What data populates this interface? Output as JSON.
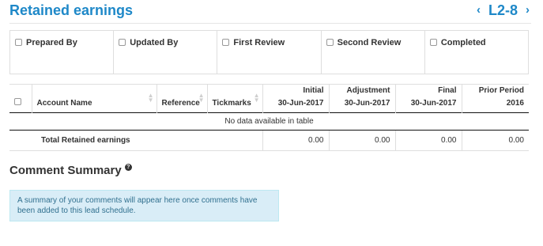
{
  "header": {
    "title": "Retained earnings",
    "prev_label": "‹",
    "code": "L2-8",
    "next_label": "›"
  },
  "signoff": [
    {
      "label": "Prepared By"
    },
    {
      "label": "Updated By"
    },
    {
      "label": "First Review"
    },
    {
      "label": "Second Review"
    },
    {
      "label": "Completed"
    }
  ],
  "table": {
    "columns": {
      "account": "Account Name",
      "reference": "Reference",
      "tickmarks": "Tickmarks",
      "initial_1": "Initial",
      "initial_2": "30-Jun-2017",
      "adjustment_1": "Adjustment",
      "adjustment_2": "30-Jun-2017",
      "final_1": "Final",
      "final_2": "30-Jun-2017",
      "prior_1": "Prior Period",
      "prior_2": "2016"
    },
    "empty_message": "No data available in table",
    "total": {
      "label": "Total Retained earnings",
      "initial": "0.00",
      "adjustment": "0.00",
      "final": "0.00",
      "prior": "0.00"
    }
  },
  "comments": {
    "title": "Comment Summary",
    "help_icon": "question-icon",
    "message": "A summary of your comments will appear here once comments have been added to this lead schedule."
  },
  "colors": {
    "accent": "#1e88c8",
    "info_bg": "#d9edf7",
    "info_text": "#31708f"
  }
}
